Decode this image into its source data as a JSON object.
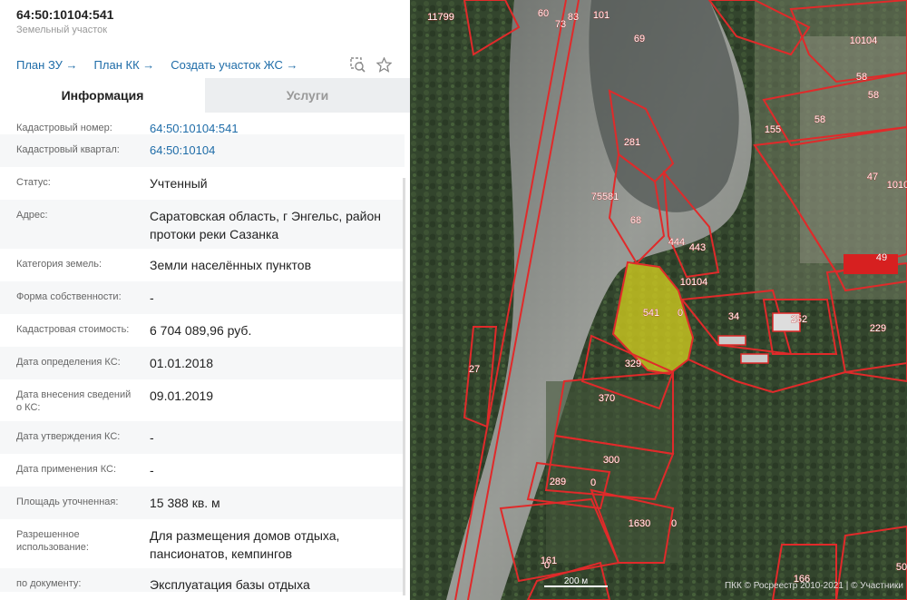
{
  "header": {
    "title": "64:50:10104:541",
    "subtitle": "Земельный участок",
    "links": [
      "План ЗУ",
      "План КК",
      "Создать участок ЖС"
    ]
  },
  "tabs": [
    {
      "label": "Информация",
      "active": true
    },
    {
      "label": "Услуги",
      "active": false
    }
  ],
  "fields": [
    {
      "label": "Кадастровый номер:",
      "value": "64:50:10104:541",
      "link": true
    },
    {
      "label": "Кадастровый квартал:",
      "value": "64:50:10104",
      "link": true
    },
    {
      "label": "Статус:",
      "value": "Учтенный"
    },
    {
      "label": "Адрес:",
      "value": "Саратовская область, г Энгельс, район протоки реки Сазанка"
    },
    {
      "label": "Категория земель:",
      "value": "Земли населённых пунктов"
    },
    {
      "label": "Форма собственности:",
      "value": "-"
    },
    {
      "label": "Кадастровая стоимость:",
      "value": "6 704 089,96 руб."
    },
    {
      "label": "Дата определения КС:",
      "value": "01.01.2018"
    },
    {
      "label": "Дата внесения сведений о КС:",
      "value": "09.01.2019"
    },
    {
      "label": "Дата утверждения КС:",
      "value": "-"
    },
    {
      "label": "Дата применения КС:",
      "value": "-"
    },
    {
      "label": "Площадь уточненная:",
      "value": "15 388 кв. м"
    },
    {
      "label": "Разрешенное использование:",
      "value": "Для размещения домов отдыха, пансионатов, кемпингов"
    },
    {
      "label": "по документу:",
      "value": "Эксплуатация базы отдыха"
    }
  ],
  "map": {
    "parcel_labels": [
      "11799",
      "60",
      "73",
      "83",
      "101",
      "10104",
      "69",
      "58",
      "58",
      "155",
      "58",
      "281",
      "47",
      "1010",
      "75581",
      "68",
      "444",
      "443",
      "10104",
      "541",
      "0",
      "252",
      "34",
      "229",
      "49",
      "27",
      "329",
      "370",
      "300",
      "289",
      "0",
      "0",
      "1630",
      "161",
      "0",
      "166",
      "50"
    ],
    "scale_label": "200 м",
    "copyright": "ПКК © Росреестр 2010-2021 | © Участники",
    "colors": {
      "boundary": "#e02a2a",
      "selected_fill": "#d8d21f"
    }
  }
}
